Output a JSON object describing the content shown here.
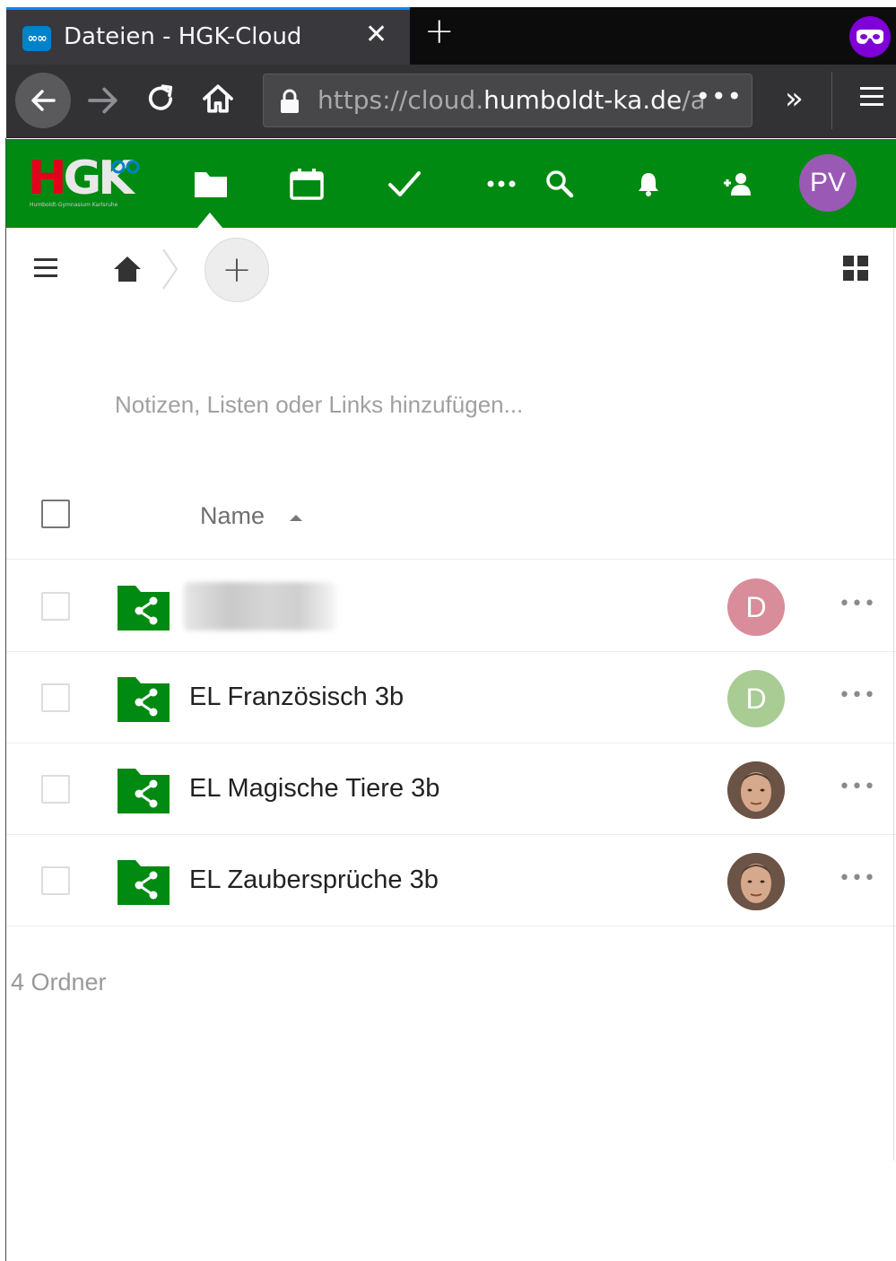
{
  "browser": {
    "tab_title": "Dateien - HGK-Cloud",
    "tab_favicon_text": "∞∞",
    "url_scheme": "https://cloud.",
    "url_host": "humboldt-ka.de",
    "url_path": "/ap",
    "url_more": "•••",
    "private_icon_color": "#8000d7"
  },
  "header": {
    "brand_color": "#008a11",
    "logo_h": "H",
    "logo_gk": "GK",
    "logo_subtitle": "Humboldt-Gymnasium Karlsruhe",
    "apps": [
      "folder-icon",
      "calendar-icon",
      "tasks-icon",
      "more-apps-icon"
    ],
    "user_initials": "PV",
    "user_color": "#9b59b6"
  },
  "breadcrumb": {
    "new_label": "+"
  },
  "notes_placeholder": "Notizen, Listen oder Links hinzufügen...",
  "table": {
    "column_name": "Name",
    "rows": [
      {
        "name": "",
        "owner_initial": "D",
        "owner_color": "#d98c9a",
        "more": "•••"
      },
      {
        "name": "EL Französisch 3b",
        "owner_initial": "D",
        "owner_color": "#a8cc94",
        "more": "•••"
      },
      {
        "name": "EL Magische Tiere 3b",
        "owner_initial": "",
        "owner_color": "#8b6a55",
        "more": "•••"
      },
      {
        "name": "EL Zaubersprüche 3b",
        "owner_initial": "",
        "owner_color": "#8b6a55",
        "more": "•••"
      }
    ]
  },
  "summary": "4 Ordner"
}
